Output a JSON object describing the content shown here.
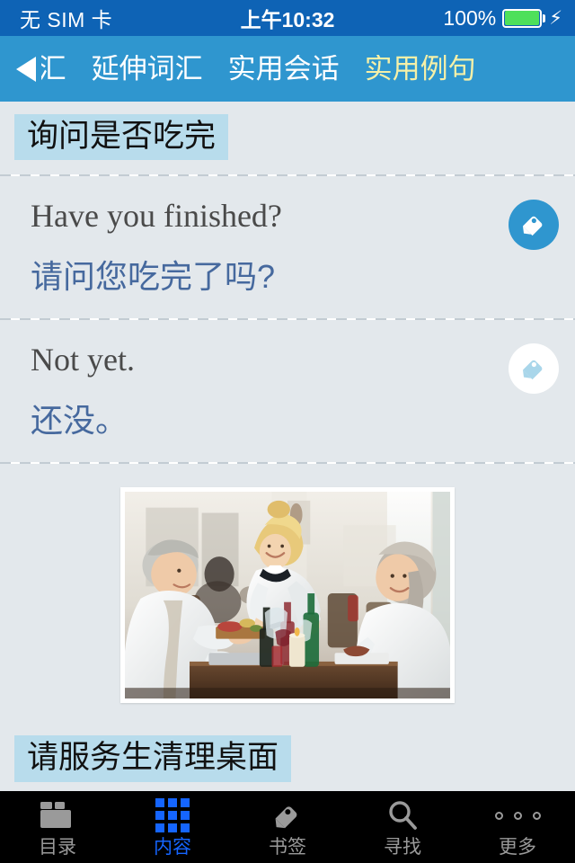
{
  "status_bar": {
    "carrier": "无 SIM 卡",
    "time": "上午10:32",
    "battery_percent": "100%",
    "battery_level": 100,
    "charging_icon": "⚡",
    "bar_color": "#0e63b5",
    "battery_fill_color": "#4ee05a"
  },
  "nav": {
    "back_icon": "back-triangle-icon",
    "bar_color": "#2f96cf",
    "active_tab_color": "#f5f0a8",
    "tabs": [
      {
        "label": "]汇",
        "active": false
      },
      {
        "label": "延伸词汇",
        "active": false
      },
      {
        "label": "实用会话",
        "active": false
      },
      {
        "label": "实用例句",
        "active": true
      }
    ]
  },
  "content": {
    "background_color": "#e3e8ec",
    "highlight_color": "#b8dcec",
    "chinese_text_color": "#46699e",
    "english_text_color": "#4a4a4a",
    "section_title": "询问是否吃完",
    "entries": [
      {
        "english": "Have you finished?",
        "chinese": "请问您吃完了吗?",
        "tag_icon": "tag-icon",
        "tag_state": "on"
      },
      {
        "english": "Not yet.",
        "chinese": "还没。",
        "tag_icon": "tag-icon",
        "tag_state": "off"
      }
    ],
    "photo": {
      "name": "restaurant-scene-photo",
      "description": "餐厅场景照片"
    },
    "next_section_title": "请服务生清理桌面"
  },
  "tabbar": {
    "background_color": "#000000",
    "inactive_color": "#9a9a9a",
    "active_color": "#1565ff",
    "items": [
      {
        "label": "目录",
        "icon": "folder-icon",
        "active": false
      },
      {
        "label": "内容",
        "icon": "grid-icon",
        "active": true
      },
      {
        "label": "书签",
        "icon": "tag-icon",
        "active": false
      },
      {
        "label": "寻找",
        "icon": "search-icon",
        "active": false
      },
      {
        "label": "更多",
        "icon": "ellipsis-icon",
        "active": false
      }
    ]
  }
}
